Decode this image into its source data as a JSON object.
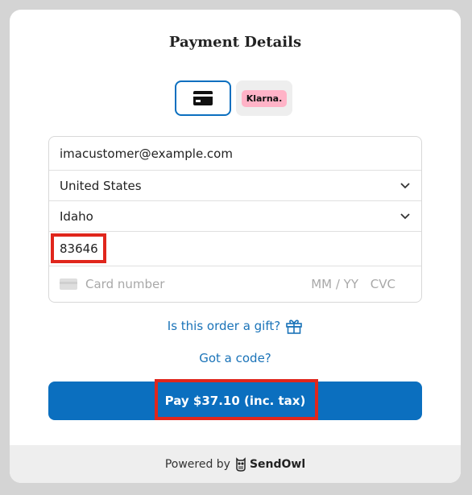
{
  "header": {
    "title": "Payment Details"
  },
  "payment_methods": {
    "card_icon": "credit-card-icon",
    "klarna_label": "Klarna."
  },
  "form": {
    "email": "imacustomer@example.com",
    "country": "United States",
    "state": "Idaho",
    "zip": "83646",
    "card_number_placeholder": "Card number",
    "expiry_placeholder": "MM / YY",
    "cvc_placeholder": "CVC"
  },
  "links": {
    "gift": "Is this order a gift?",
    "code": "Got a code?"
  },
  "pay_button": {
    "label": "Pay $37.10 (inc. tax)"
  },
  "footer": {
    "powered_by": "Powered by",
    "brand": "SendOwl"
  },
  "colors": {
    "accent": "#0b6fbf",
    "highlight": "#e0261c",
    "klarna_pink": "#ffb3c7"
  }
}
